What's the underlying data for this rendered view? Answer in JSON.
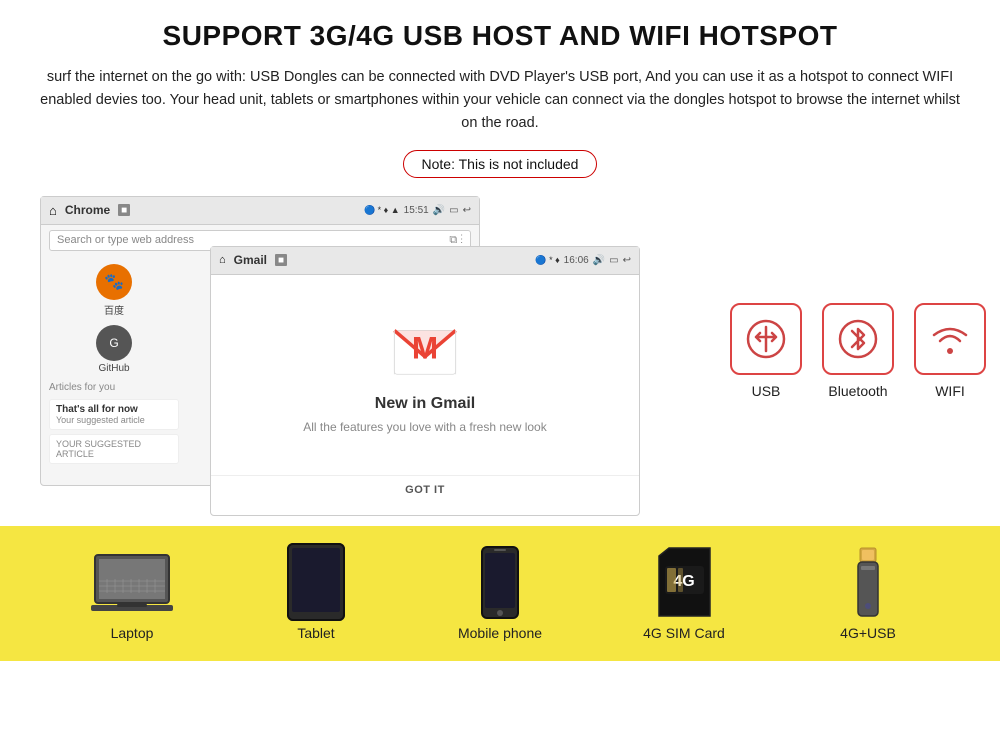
{
  "header": {
    "title": "SUPPORT 3G/4G USB HOST AND WIFI HOTSPOT",
    "description": "surf the internet on the go with: USB Dongles can be connected with DVD Player's USB port, And you can use it as a hotspot to connect WIFI enabled devies too. Your head unit, tablets or smartphones within your vehicle can connect via the dongles hotspot to browse the internet whilst on the road.",
    "note": "Note: This is not included"
  },
  "browser": {
    "title": "Chrome",
    "time": "15:51",
    "search_placeholder": "Search or type web address"
  },
  "gmail": {
    "title": "Gmail",
    "time": "16:06",
    "email_title": "New in Gmail",
    "email_sub": "All the features you love with a fresh new look",
    "got_it": "GOT IT"
  },
  "connectivity_icons": [
    {
      "id": "usb",
      "label": "USB",
      "symbol": "⚡"
    },
    {
      "id": "bluetooth",
      "label": "Bluetooth",
      "symbol": "✱"
    },
    {
      "id": "wifi",
      "label": "WIFI",
      "symbol": "📶"
    }
  ],
  "devices": [
    {
      "id": "laptop",
      "label": "Laptop"
    },
    {
      "id": "tablet",
      "label": "Tablet"
    },
    {
      "id": "mobile-phone",
      "label": "Mobile phone"
    },
    {
      "id": "sim-card",
      "label": "4G SIM Card",
      "text": "4G"
    },
    {
      "id": "usb-drive",
      "label": "4G+USB"
    }
  ],
  "apps": [
    {
      "label": "百度",
      "bg": "#e87000",
      "char": "🐾"
    },
    {
      "label": "GitHub",
      "bg": "#555",
      "char": "G"
    }
  ]
}
